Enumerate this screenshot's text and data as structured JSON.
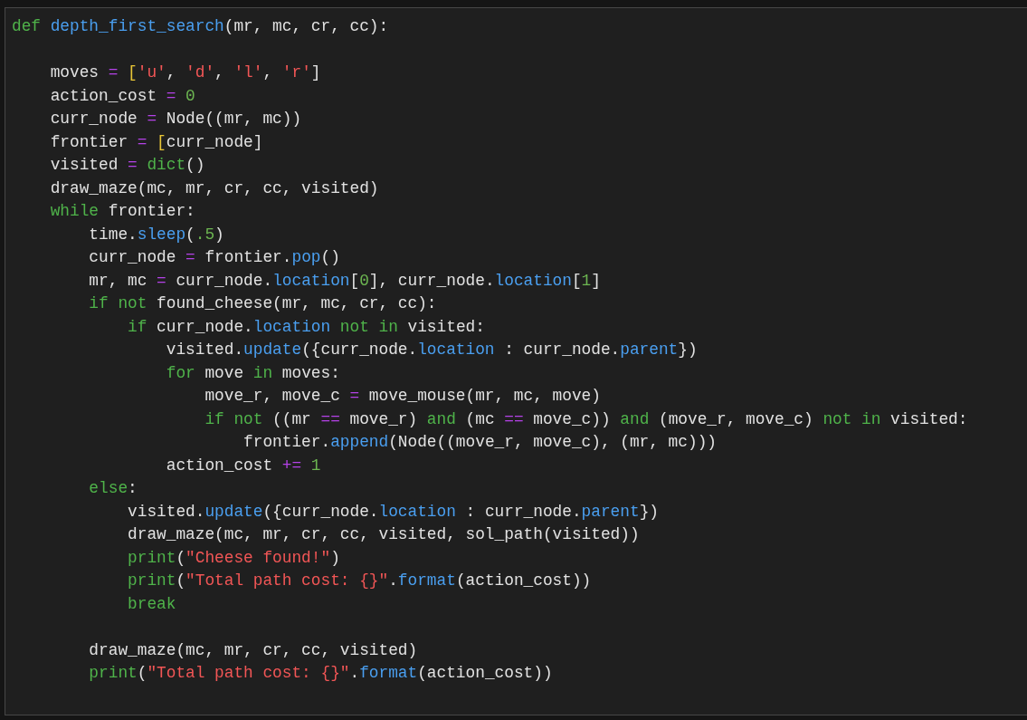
{
  "code_blocks": [
    [
      [
        {
          "t": "def",
          "kind": "keyword"
        },
        {
          "t": " depth_first_search",
          "kind": "name"
        },
        {
          "t": "(mr, mc, cr, cc):",
          "kind": "plain"
        }
      ]
    ],
    [
      [
        {
          "t": "    moves ",
          "kind": "plain"
        },
        {
          "t": "=",
          "kind": "operator"
        },
        {
          "t": " [",
          "kind": "bracket"
        },
        {
          "t": "'u'",
          "kind": "string"
        },
        {
          "t": ", ",
          "kind": "plain"
        },
        {
          "t": "'d'",
          "kind": "string"
        },
        {
          "t": ", ",
          "kind": "plain"
        },
        {
          "t": "'l'",
          "kind": "string"
        },
        {
          "t": ", ",
          "kind": "plain"
        },
        {
          "t": "'r'",
          "kind": "string"
        },
        {
          "t": "]",
          "kind": "plain"
        }
      ],
      [
        {
          "t": "    action_cost ",
          "kind": "plain"
        },
        {
          "t": "=",
          "kind": "operator"
        },
        {
          "t": " 0",
          "kind": "number"
        }
      ],
      [
        {
          "t": "    curr_node ",
          "kind": "plain"
        },
        {
          "t": "=",
          "kind": "operator"
        },
        {
          "t": " Node((mr, mc))",
          "kind": "plain"
        }
      ],
      [
        {
          "t": "    frontier ",
          "kind": "plain"
        },
        {
          "t": "=",
          "kind": "operator"
        },
        {
          "t": " [",
          "kind": "bracket"
        },
        {
          "t": "curr_node]",
          "kind": "plain"
        }
      ],
      [
        {
          "t": "    visited ",
          "kind": "plain"
        },
        {
          "t": "=",
          "kind": "operator"
        },
        {
          "t": " dict",
          "kind": "keyword"
        },
        {
          "t": "()",
          "kind": "plain"
        }
      ],
      [
        {
          "t": "    draw_maze(mc, mr, cr, cc, visited)",
          "kind": "plain"
        }
      ],
      [
        {
          "t": "    while",
          "kind": "keyword"
        },
        {
          "t": " frontier:",
          "kind": "plain"
        }
      ],
      [
        {
          "t": "        time.",
          "kind": "plain"
        },
        {
          "t": "sleep",
          "kind": "name"
        },
        {
          "t": "(",
          "kind": "plain"
        },
        {
          "t": ".5",
          "kind": "number"
        },
        {
          "t": ")",
          "kind": "plain"
        }
      ],
      [
        {
          "t": "        curr_node ",
          "kind": "plain"
        },
        {
          "t": "=",
          "kind": "operator"
        },
        {
          "t": " frontier.",
          "kind": "plain"
        },
        {
          "t": "pop",
          "kind": "name"
        },
        {
          "t": "()",
          "kind": "plain"
        }
      ],
      [
        {
          "t": "        mr, mc ",
          "kind": "plain"
        },
        {
          "t": "=",
          "kind": "operator"
        },
        {
          "t": " curr_node.",
          "kind": "plain"
        },
        {
          "t": "location",
          "kind": "name"
        },
        {
          "t": "[",
          "kind": "plain"
        },
        {
          "t": "0",
          "kind": "number"
        },
        {
          "t": "], curr_node.",
          "kind": "plain"
        },
        {
          "t": "location",
          "kind": "name"
        },
        {
          "t": "[",
          "kind": "plain"
        },
        {
          "t": "1",
          "kind": "number"
        },
        {
          "t": "]",
          "kind": "plain"
        }
      ],
      [
        {
          "t": "        if not",
          "kind": "keyword"
        },
        {
          "t": " found_cheese(mr, mc, cr, cc):",
          "kind": "plain"
        }
      ],
      [
        {
          "t": "            if",
          "kind": "keyword"
        },
        {
          "t": " curr_node.",
          "kind": "plain"
        },
        {
          "t": "location",
          "kind": "name"
        },
        {
          "t": " not in",
          "kind": "keyword"
        },
        {
          "t": " visited:",
          "kind": "plain"
        }
      ],
      [
        {
          "t": "                visited.",
          "kind": "plain"
        },
        {
          "t": "update",
          "kind": "name"
        },
        {
          "t": "({curr_node.",
          "kind": "plain"
        },
        {
          "t": "location",
          "kind": "name"
        },
        {
          "t": " : curr_node.",
          "kind": "plain"
        },
        {
          "t": "parent",
          "kind": "name"
        },
        {
          "t": "})",
          "kind": "plain"
        }
      ],
      [
        {
          "t": "                for",
          "kind": "keyword"
        },
        {
          "t": " move ",
          "kind": "plain"
        },
        {
          "t": "in",
          "kind": "keyword"
        },
        {
          "t": " moves:",
          "kind": "plain"
        }
      ],
      [
        {
          "t": "                    move_r, move_c ",
          "kind": "plain"
        },
        {
          "t": "=",
          "kind": "operator"
        },
        {
          "t": " move_mouse(mr, mc, move)",
          "kind": "plain"
        }
      ],
      [
        {
          "t": "                    if not",
          "kind": "keyword"
        },
        {
          "t": " ((mr ",
          "kind": "plain"
        },
        {
          "t": "==",
          "kind": "operator"
        },
        {
          "t": " move_r) ",
          "kind": "plain"
        },
        {
          "t": "and",
          "kind": "keyword"
        },
        {
          "t": " (mc ",
          "kind": "plain"
        },
        {
          "t": "==",
          "kind": "operator"
        },
        {
          "t": " move_c)) ",
          "kind": "plain"
        },
        {
          "t": "and",
          "kind": "keyword"
        },
        {
          "t": " (move_r, move_c) ",
          "kind": "plain"
        },
        {
          "t": "not in",
          "kind": "keyword"
        },
        {
          "t": " visited:",
          "kind": "plain"
        }
      ],
      [
        {
          "t": "                        frontier.",
          "kind": "plain"
        },
        {
          "t": "append",
          "kind": "name"
        },
        {
          "t": "(Node((move_r, move_c), (mr, mc)))",
          "kind": "plain"
        }
      ],
      [
        {
          "t": "                action_cost ",
          "kind": "plain"
        },
        {
          "t": "+=",
          "kind": "operator"
        },
        {
          "t": " 1",
          "kind": "number"
        }
      ],
      [
        {
          "t": "        else",
          "kind": "keyword"
        },
        {
          "t": ":",
          "kind": "plain"
        }
      ],
      [
        {
          "t": "            visited.",
          "kind": "plain"
        },
        {
          "t": "update",
          "kind": "name"
        },
        {
          "t": "({curr_node.",
          "kind": "plain"
        },
        {
          "t": "location",
          "kind": "name"
        },
        {
          "t": " : curr_node.",
          "kind": "plain"
        },
        {
          "t": "parent",
          "kind": "name"
        },
        {
          "t": "})",
          "kind": "plain"
        }
      ],
      [
        {
          "t": "            draw_maze(mc, mr, cr, cc, visited, sol_path(visited))",
          "kind": "plain"
        }
      ],
      [
        {
          "t": "            print",
          "kind": "keyword"
        },
        {
          "t": "(",
          "kind": "plain"
        },
        {
          "t": "\"Cheese found!\"",
          "kind": "string"
        },
        {
          "t": ")",
          "kind": "plain"
        }
      ],
      [
        {
          "t": "            print",
          "kind": "keyword"
        },
        {
          "t": "(",
          "kind": "plain"
        },
        {
          "t": "\"Total path cost: {}\"",
          "kind": "string"
        },
        {
          "t": ".",
          "kind": "plain"
        },
        {
          "t": "format",
          "kind": "name"
        },
        {
          "t": "(action_cost))",
          "kind": "plain"
        }
      ],
      [
        {
          "t": "            break",
          "kind": "keyword"
        }
      ]
    ],
    [
      [
        {
          "t": "        draw_maze(mc, mr, cr, cc, visited)",
          "kind": "plain"
        }
      ],
      [
        {
          "t": "        print",
          "kind": "keyword"
        },
        {
          "t": "(",
          "kind": "plain"
        },
        {
          "t": "\"Total path cost: {}\"",
          "kind": "string"
        },
        {
          "t": ".",
          "kind": "plain"
        },
        {
          "t": "format",
          "kind": "name"
        },
        {
          "t": "(action_cost))",
          "kind": "plain"
        }
      ]
    ]
  ]
}
